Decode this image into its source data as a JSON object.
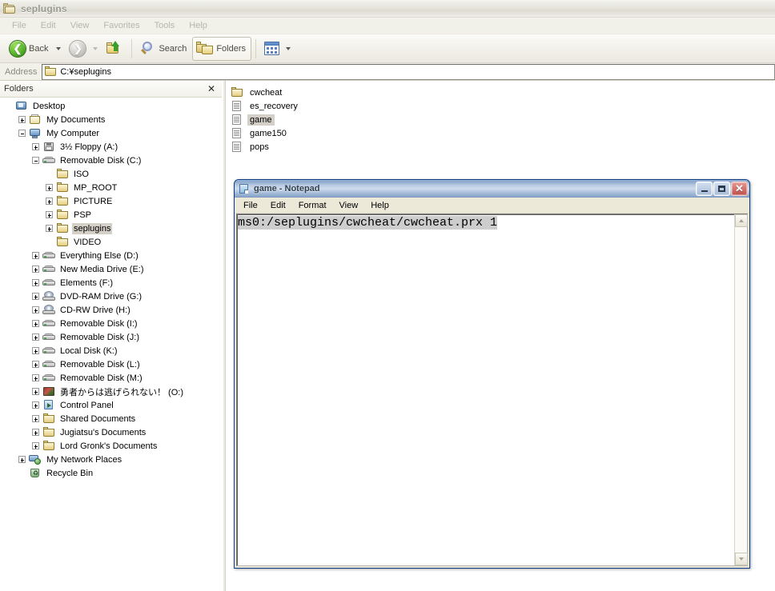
{
  "explorer": {
    "title": "seplugins",
    "title_icon": "folder-icon",
    "menus": [
      "File",
      "Edit",
      "View",
      "Favorites",
      "Tools",
      "Help"
    ],
    "toolbar": {
      "back_label": "Back",
      "back_icon": "back-arrow-icon",
      "forward_icon": "forward-arrow-icon",
      "up_icon": "up-folder-icon",
      "search_label": "Search",
      "search_icon": "magnifier-icon",
      "folders_label": "Folders",
      "folders_icon": "folders-icon",
      "views_icon": "views-icon"
    },
    "address": {
      "label": "Address",
      "value": "C:¥seplugins",
      "icon": "folder-icon"
    },
    "folders_pane": {
      "header": "Folders",
      "close_icon": "close-icon",
      "tree": [
        {
          "label": "Desktop",
          "indent": 0,
          "expander": "none",
          "icon": "desktop-icon",
          "selected": false
        },
        {
          "label": "My Documents",
          "indent": 1,
          "expander": "plus",
          "icon": "mydocs-icon",
          "selected": false
        },
        {
          "label": "My Computer",
          "indent": 1,
          "expander": "minus",
          "icon": "computer-icon",
          "selected": false
        },
        {
          "label": "3½ Floppy (A:)",
          "indent": 2,
          "expander": "plus",
          "icon": "floppy-icon",
          "selected": false
        },
        {
          "label": "Removable Disk (C:)",
          "indent": 2,
          "expander": "minus",
          "icon": "drive-icon",
          "selected": false
        },
        {
          "label": "ISO",
          "indent": 3,
          "expander": "none",
          "icon": "folder-icon",
          "selected": false
        },
        {
          "label": "MP_ROOT",
          "indent": 3,
          "expander": "plus",
          "icon": "folder-icon",
          "selected": false
        },
        {
          "label": "PICTURE",
          "indent": 3,
          "expander": "plus",
          "icon": "folder-icon",
          "selected": false
        },
        {
          "label": "PSP",
          "indent": 3,
          "expander": "plus",
          "icon": "folder-icon",
          "selected": false
        },
        {
          "label": "seplugins",
          "indent": 3,
          "expander": "plus",
          "icon": "folder-icon",
          "selected": true
        },
        {
          "label": "VIDEO",
          "indent": 3,
          "expander": "none",
          "icon": "folder-icon",
          "selected": false
        },
        {
          "label": "Everything Else (D:)",
          "indent": 2,
          "expander": "plus",
          "icon": "drive-icon",
          "selected": false
        },
        {
          "label": "New Media Drive (E:)",
          "indent": 2,
          "expander": "plus",
          "icon": "drive-icon",
          "selected": false
        },
        {
          "label": "Elements (F:)",
          "indent": 2,
          "expander": "plus",
          "icon": "drive-icon",
          "selected": false
        },
        {
          "label": "DVD-RAM Drive (G:)",
          "indent": 2,
          "expander": "plus",
          "icon": "cd-drive-icon",
          "selected": false
        },
        {
          "label": "CD-RW Drive (H:)",
          "indent": 2,
          "expander": "plus",
          "icon": "cd-drive-icon",
          "selected": false
        },
        {
          "label": "Removable Disk (I:)",
          "indent": 2,
          "expander": "plus",
          "icon": "drive-icon",
          "selected": false
        },
        {
          "label": "Removable Disk (J:)",
          "indent": 2,
          "expander": "plus",
          "icon": "drive-icon",
          "selected": false
        },
        {
          "label": "Local Disk (K:)",
          "indent": 2,
          "expander": "plus",
          "icon": "drive-icon",
          "selected": false
        },
        {
          "label": "Removable Disk (L:)",
          "indent": 2,
          "expander": "plus",
          "icon": "drive-icon",
          "selected": false
        },
        {
          "label": "Removable Disk (M:)",
          "indent": 2,
          "expander": "plus",
          "icon": "drive-icon",
          "selected": false
        },
        {
          "label": "勇者からは逃げられない！ (O:)",
          "indent": 2,
          "expander": "plus",
          "icon": "game-disc-icon",
          "selected": false
        },
        {
          "label": "Control Panel",
          "indent": 2,
          "expander": "plus",
          "icon": "control-panel-icon",
          "selected": false
        },
        {
          "label": "Shared Documents",
          "indent": 2,
          "expander": "plus",
          "icon": "folder-icon",
          "selected": false
        },
        {
          "label": "Jugiatsu's Documents",
          "indent": 2,
          "expander": "plus",
          "icon": "folder-icon",
          "selected": false
        },
        {
          "label": "Lord Gronk's Documents",
          "indent": 2,
          "expander": "plus",
          "icon": "folder-icon",
          "selected": false
        },
        {
          "label": "My Network Places",
          "indent": 1,
          "expander": "plus",
          "icon": "network-places-icon",
          "selected": false
        },
        {
          "label": "Recycle Bin",
          "indent": 1,
          "expander": "none",
          "icon": "recycle-bin-icon",
          "selected": false
        }
      ]
    },
    "files": [
      {
        "label": "cwcheat",
        "icon": "folder-icon",
        "selected": false
      },
      {
        "label": "es_recovery",
        "icon": "text-file-icon",
        "selected": false
      },
      {
        "label": "game",
        "icon": "text-file-icon",
        "selected": true
      },
      {
        "label": "game150",
        "icon": "text-file-icon",
        "selected": false
      },
      {
        "label": "pops",
        "icon": "text-file-icon",
        "selected": false
      }
    ]
  },
  "notepad": {
    "title": "game - Notepad",
    "icon": "notepad-icon",
    "window_controls": {
      "minimize": "minimize-icon",
      "maximize": "maximize-icon",
      "close": "close-icon",
      "close_glyph": "✕"
    },
    "menus": [
      "File",
      "Edit",
      "Format",
      "View",
      "Help"
    ],
    "document_text": "ms0:/seplugins/cwcheat/cwcheat.prx 1",
    "selection_color": "#cdcdcd",
    "scrollbar": {
      "up_icon": "scroll-up-icon",
      "down_icon": "scroll-down-icon"
    }
  }
}
